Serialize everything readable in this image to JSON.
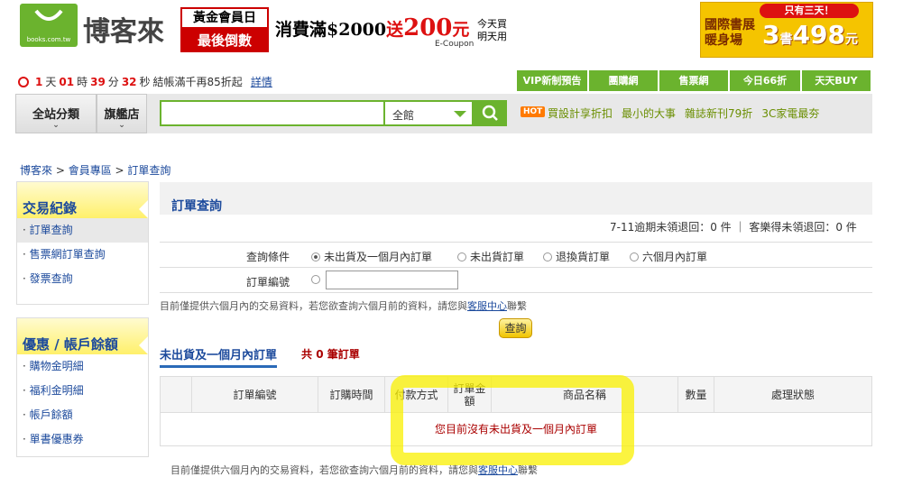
{
  "header": {
    "logo_text": "博客來",
    "logo_sub": "books.com.tw",
    "promo1_top": "黃金會員日",
    "promo1_bottom": "最後倒數",
    "promo2_prefix": "消費滿$2000",
    "promo2_send": "送",
    "promo2_amount": "200",
    "promo2_unit": "元",
    "promo2_coupon": "E-Coupon",
    "promo2_today1": "今天買",
    "promo2_today2": "明天用",
    "ad_badge": "只有三天！",
    "ad_line1": "國際書展",
    "ad_line2": "暖身場",
    "ad_big": "3",
    "ad_books": "書",
    "ad_price": "498",
    "ad_yuan": "元"
  },
  "countdown": {
    "days": "1",
    "days_label": "天",
    "hours": "01",
    "hours_label": "時",
    "minutes": "39",
    "minutes_label": "分",
    "seconds": "32",
    "seconds_label": "秒",
    "text": "結帳滿千再85折起",
    "link": "詳情"
  },
  "topnav": [
    "VIP新制預告",
    "團購網",
    "售票網",
    "今日66折",
    "天天BUY"
  ],
  "nav": {
    "category_button": "全站分類",
    "flagship_button": "旗艦店",
    "search_value": "",
    "scope_select": "全館",
    "hot_badge": "HOT",
    "hot_links": [
      "買設計享折扣",
      "最小的大事",
      "雜誌新刊79折",
      "3C家電最夯"
    ]
  },
  "breadcrumb": [
    "博客來",
    "會員專區",
    "訂單查詢"
  ],
  "sidebar": {
    "box1_title": "交易紀錄",
    "box1_items": [
      "訂單查詢",
      "售票網訂單查詢",
      "發票查詢"
    ],
    "box2_title": "優惠 / 帳戶餘額",
    "box2_items": [
      "購物金明細",
      "福利金明細",
      "帳戶餘額",
      "單書優惠券"
    ]
  },
  "main": {
    "title": "訂單查詢",
    "stat": "7-11逾期未領退回：0 件 ｜ 客樂得未領退回：0 件",
    "condition_label": "查詢條件",
    "options": [
      "未出貨及一個月內訂單",
      "未出貨訂單",
      "退換貨訂單",
      "六個月內訂單"
    ],
    "selected_option": "未出貨及一個月內訂單",
    "order_no_label": "訂單編號",
    "order_no_value": "",
    "notice": "目前僅提供六個月內的交易資料，若您欲查詢六個月前的資料，請您與",
    "notice_link": "客服中心",
    "notice_tail": "聯繫",
    "query_button": "查詢",
    "section_title": "未出貨及一個月內訂單",
    "count_prefix": "共",
    "count": "0",
    "count_suffix": "筆訂單",
    "columns": [
      "",
      "訂單編號",
      "訂購時間",
      "付款方式",
      "訂單金額",
      "商品名稱",
      "數量",
      "處理狀態"
    ],
    "empty_message": "您目前沒有未出貨及一個月內訂單"
  }
}
